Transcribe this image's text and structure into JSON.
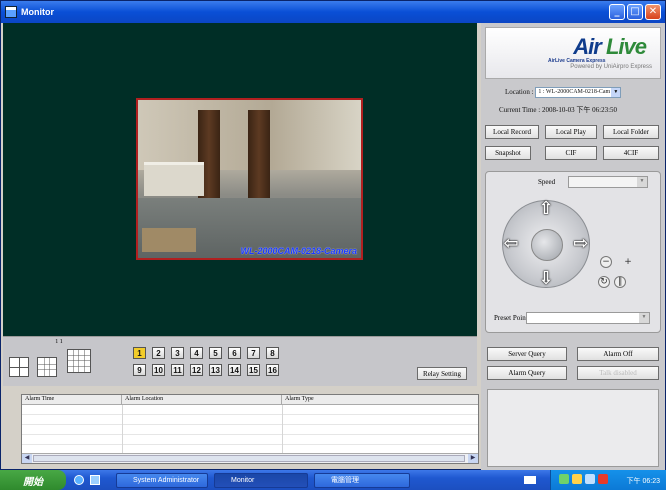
{
  "window": {
    "title": "Monitor"
  },
  "video": {
    "camera_label": "WL-2000CAM-0218-Camera"
  },
  "logo": {
    "main_air": "Air",
    "main_live": "Live",
    "sub1": "AirLive Camera Express",
    "sub2": "Powered by UniAirpro Express"
  },
  "info": {
    "location_label": "Location :",
    "location_value": "1 : WL-2000CAM-0218-Cam",
    "time_label": "Current Time :",
    "time_value": "2008-10-03 下午 06:23:50"
  },
  "buttons": {
    "local_record": "Local Record",
    "local_play": "Local Play",
    "local_folder": "Local Folder",
    "snapshot": "Snapshot",
    "cif": "CIF",
    "four_cif": "4CIF",
    "server_query": "Server Query",
    "alarm_off": "Alarm Off",
    "alarm_query": "Alarm Query",
    "talk": "Talk disabled",
    "relay_setting": "Relay Setting"
  },
  "ptz": {
    "speed_label": "Speed",
    "preset_label": "Preset Point"
  },
  "layout": {
    "split_indicator": "1 1",
    "channels": [
      "1",
      "2",
      "3",
      "4",
      "5",
      "6",
      "7",
      "8",
      "9",
      "10",
      "11",
      "12",
      "13",
      "14",
      "15",
      "16"
    ],
    "active_channel": "1"
  },
  "alarm_table": {
    "headers": [
      "Alarm Time",
      "Alarm Location",
      "Alarm Type"
    ]
  },
  "taskbar": {
    "start": "開始",
    "items": [
      "System Administrator",
      "Monitor",
      "電腦管理"
    ],
    "clock": "下午 06:23"
  }
}
